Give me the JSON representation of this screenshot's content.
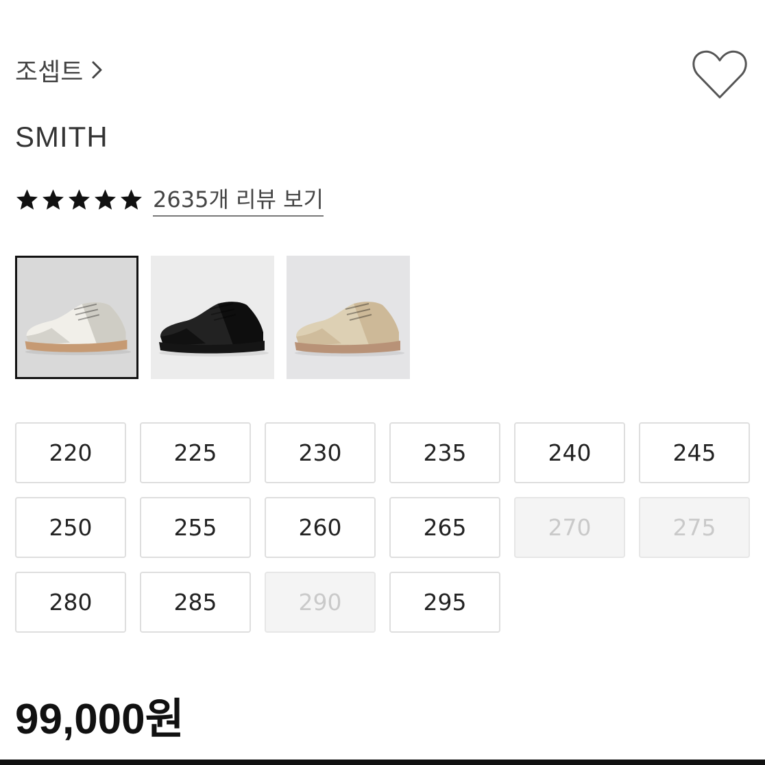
{
  "brand": {
    "name": "조셉트",
    "chevron_icon": "chevron-right-icon"
  },
  "wishlist": {
    "icon": "heart-outline-icon"
  },
  "product": {
    "name": "SMITH",
    "price": "99,000원"
  },
  "rating": {
    "stars": 5,
    "star_icon": "star-icon",
    "review_link": "2635개 리뷰 보기"
  },
  "colors": [
    {
      "name": "white-sneaker",
      "upper": "#f1efe9",
      "suede": "#cfcdc5",
      "sole": "#c69a73",
      "bg": "#d9d9d9",
      "selected": true
    },
    {
      "name": "black-sneaker",
      "upper": "#222222",
      "suede": "#0e0e0e",
      "sole": "#151515",
      "bg": "#ececec",
      "selected": false
    },
    {
      "name": "beige-sneaker",
      "upper": "#ddd0b4",
      "suede": "#cdb998",
      "sole": "#b89277",
      "bg": "#e4e4e6",
      "selected": false
    }
  ],
  "sizes": [
    {
      "label": "220",
      "available": true
    },
    {
      "label": "225",
      "available": true
    },
    {
      "label": "230",
      "available": true
    },
    {
      "label": "235",
      "available": true
    },
    {
      "label": "240",
      "available": true
    },
    {
      "label": "245",
      "available": true
    },
    {
      "label": "250",
      "available": true
    },
    {
      "label": "255",
      "available": true
    },
    {
      "label": "260",
      "available": true
    },
    {
      "label": "265",
      "available": true
    },
    {
      "label": "270",
      "available": false
    },
    {
      "label": "275",
      "available": false
    },
    {
      "label": "280",
      "available": true
    },
    {
      "label": "285",
      "available": true
    },
    {
      "label": "290",
      "available": false
    },
    {
      "label": "295",
      "available": true
    }
  ]
}
